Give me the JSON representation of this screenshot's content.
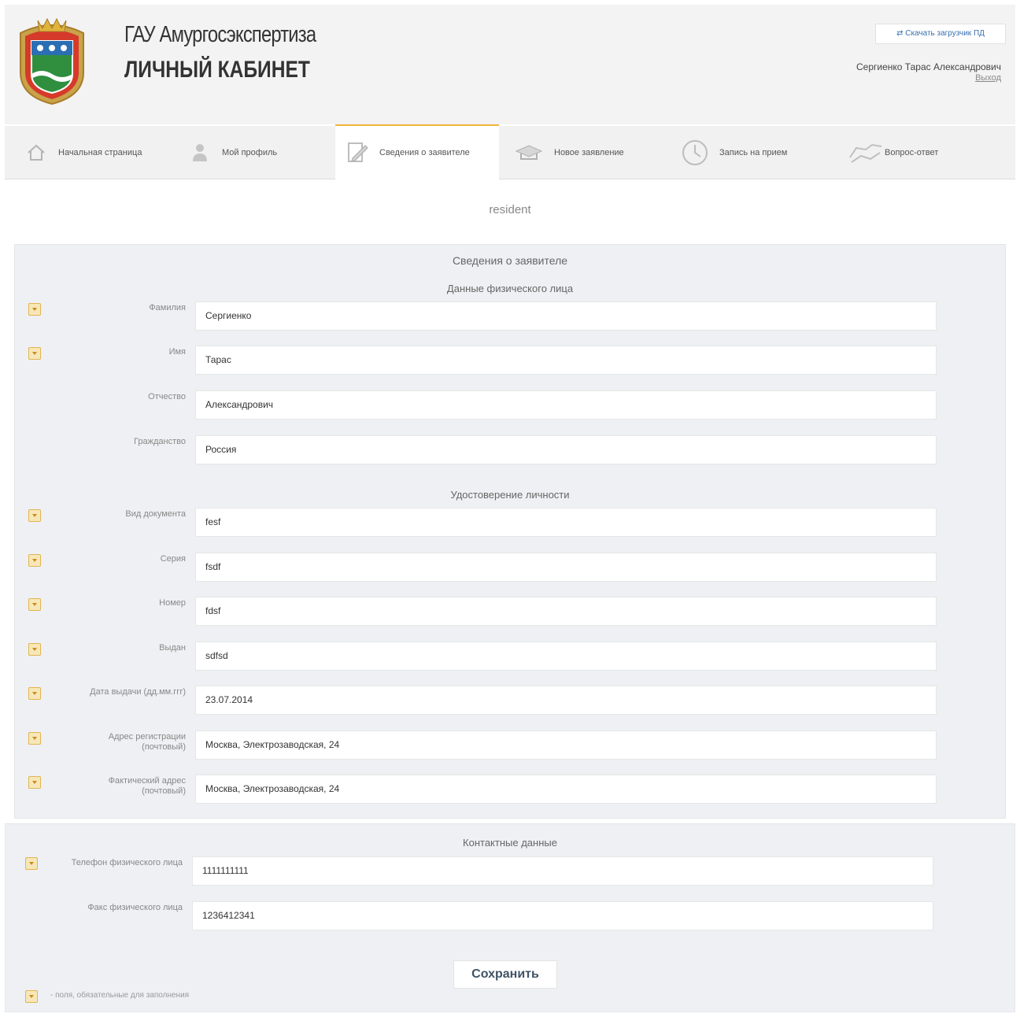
{
  "header": {
    "org_name": "ГАУ Амургосэкспертиза",
    "cabinet_label": "ЛИЧНЫЙ КАБИНЕТ",
    "download_label": "Скачать загрузчик ПД",
    "user_name": "Сергиенко Тарас Александрович",
    "logout_label": "Выход"
  },
  "nav": {
    "items": [
      {
        "label": "Начальная страница",
        "icon": "home-icon"
      },
      {
        "label": "Мой профиль",
        "icon": "user-icon"
      },
      {
        "label": "Сведения о заявителе",
        "icon": "edit-document-icon",
        "active": true
      },
      {
        "label": "Новое заявление",
        "icon": "new-application-icon"
      },
      {
        "label": "Запись на прием",
        "icon": "clock-icon"
      },
      {
        "label": "Вопрос-ответ",
        "icon": "handshake-icon"
      }
    ]
  },
  "page_subtitle": "resident",
  "form": {
    "title": "Сведения о заявителе",
    "person_section": "Данные физического лица",
    "id_section": "Удостоверение личности",
    "contact_section": "Контактные данные",
    "fields": {
      "surname": {
        "label": "Фамилия",
        "value": "Сергиенко",
        "required": true
      },
      "name": {
        "label": "Имя",
        "value": "Тарас",
        "required": true
      },
      "patronymic": {
        "label": "Отчество",
        "value": "Александрович",
        "required": false
      },
      "citizenship": {
        "label": "Гражданство",
        "value": "Россия",
        "required": false
      },
      "doc_type": {
        "label": "Вид документа",
        "value": "fesf",
        "required": true
      },
      "series": {
        "label": "Серия",
        "value": "fsdf",
        "required": true
      },
      "number": {
        "label": "Номер",
        "value": "fdsf",
        "required": true
      },
      "issued_by": {
        "label": "Выдан",
        "value": "sdfsd",
        "required": true
      },
      "issue_date": {
        "label": "Дата выдачи (дд.мм.ггг)",
        "value": "23.07.2014",
        "required": true
      },
      "reg_address_1": {
        "label": "Адрес регистрации",
        "label2": "(почтовый)",
        "value": "Москва, Электрозаводская, 24",
        "required": true
      },
      "fact_address": {
        "label": "Фактический адрес",
        "label2": "(почтовый)",
        "value": "Москва, Электрозаводская, 24",
        "required": true
      },
      "phone": {
        "label": "Телефон физического лица",
        "value": "1111111111",
        "required": true
      },
      "fax": {
        "label": "Факс физического лица",
        "value": "1236412341",
        "required": false
      }
    },
    "save_label": "Сохранить",
    "required_note": "- поля, обязательные для заполнения"
  },
  "colors": {
    "accent": "#f0b43c",
    "panel": "#eef0f3",
    "link": "#3a6fb0"
  }
}
